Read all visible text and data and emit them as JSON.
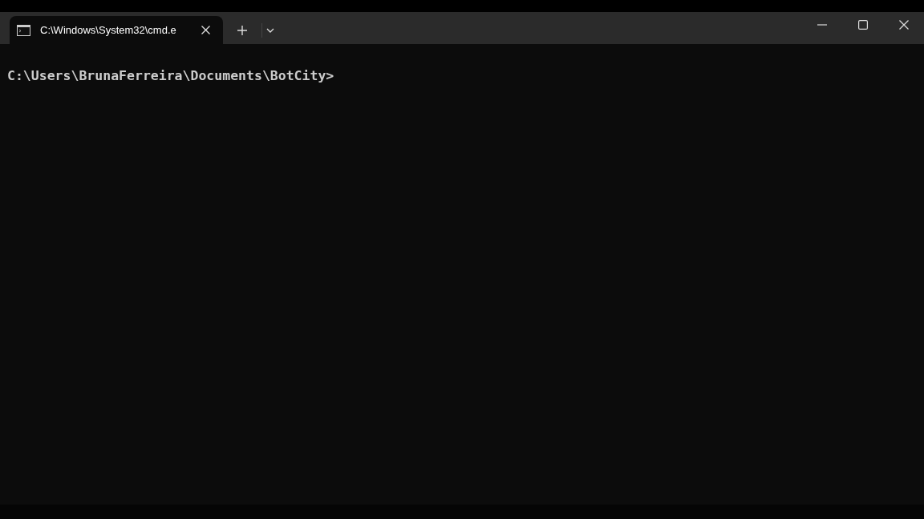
{
  "tabs": [
    {
      "title": "C:\\Windows\\System32\\cmd.e",
      "selected": true
    }
  ],
  "terminal": {
    "lines": [
      "C:\\Users\\BrunaFerreira\\Documents\\BotCity>"
    ]
  }
}
